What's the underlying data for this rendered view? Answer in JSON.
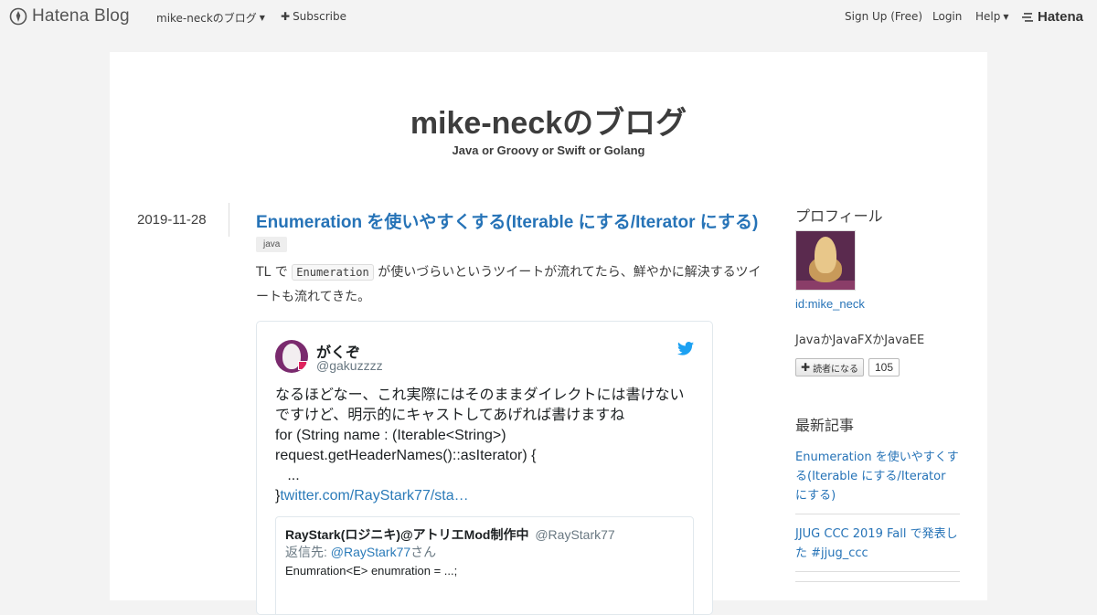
{
  "globalbar": {
    "logo_text": "Hatena Blog",
    "blog_menu_label": "mike-neckのブログ",
    "subscribe_label": "Subscribe",
    "signup_label": "Sign Up (Free)",
    "login_label": "Login",
    "help_label": "Help",
    "hatena_logo_text": "Hatena"
  },
  "blog": {
    "title": "mike-neckのブログ",
    "description": "Java or Groovy or Swift or Golang"
  },
  "entry": {
    "date": "2019-11-28",
    "title": "Enumeration を使いやすくする(Iterable にする/Iterator にする)",
    "category": "java",
    "body_prefix": "TL で",
    "body_code": "Enumeration",
    "body_suffix": "が使いづらいというツイートが流れてたら、鮮やかに解決するツイートも流れてきた。"
  },
  "tweet": {
    "name": "がくぞ",
    "handle": "@gakuzzzz",
    "lines": [
      "なるほどなー、これ実際にはそのままダイレクトには書けない",
      "ですけど、明示的にキャストしてあげれば書けますね",
      "for (String name : (Iterable<String>)",
      "request.getHeaderNames()::asIterator) {",
      "   ..."
    ],
    "last_line_prefix": "}",
    "link_text": "twitter.com/RayStark77/sta…",
    "quoted": {
      "name": "RayStark(ロジニキ)@アトリエMod制作中",
      "handle": "@RayStark77",
      "reply_prefix": "返信先: ",
      "reply_link": "@RayStark77",
      "reply_suffix": "さん",
      "text": "Enumration<E> enumration = ...;"
    }
  },
  "sidebar": {
    "profile_heading": "プロフィール",
    "profile_id": "id:mike_neck",
    "profile_desc": "JavaかJavaFXかJavaEE",
    "subscribe_button": "読者になる",
    "reader_count": "105",
    "recent_heading": "最新記事",
    "recent_items": [
      "Enumeration を使いやすくする(Iterable にする/Iterator にする)",
      "JJUG CCC 2019 Fall で発表した #jjug_ccc"
    ]
  },
  "colors": {
    "link": "#2673b7",
    "background": "#f3f3f3",
    "twitter_blue": "#1da1f2"
  }
}
